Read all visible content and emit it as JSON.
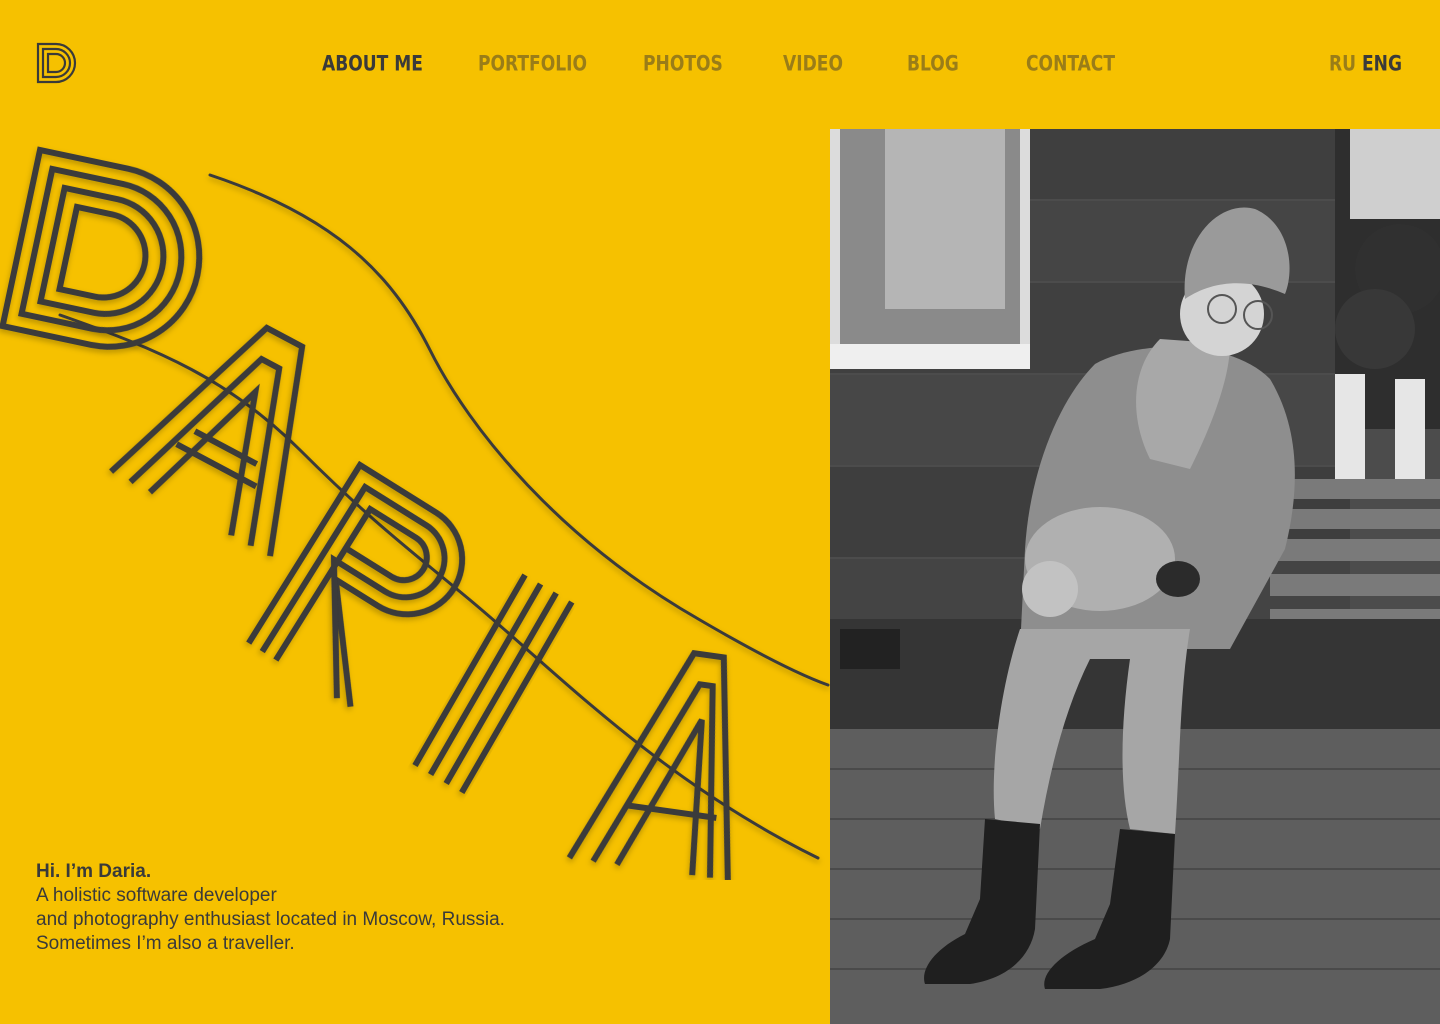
{
  "nav": {
    "items": [
      {
        "label": "ABOUT ME",
        "active": true
      },
      {
        "label": "PORTFOLIO",
        "active": false
      },
      {
        "label": "PHOTOS",
        "active": false
      },
      {
        "label": "VIDEO",
        "active": false
      },
      {
        "label": "BLOG",
        "active": false
      },
      {
        "label": "CONTACT",
        "active": false
      }
    ]
  },
  "lang": {
    "ru": "RU",
    "eng": "ENG"
  },
  "hero": {
    "word": "DARIA"
  },
  "intro": {
    "greeting": "Hi. I’m Daria.",
    "line1": "A holistic software developer",
    "line2": "and photography enthusiast located in Moscow, Russia.",
    "line3": "Sometimes I’m also a traveller."
  },
  "photo": {
    "description_icon": "portrait-photo"
  },
  "colors": {
    "background": "#f6c100",
    "ink": "#3a3a3a",
    "muted": "#9a7d18"
  }
}
